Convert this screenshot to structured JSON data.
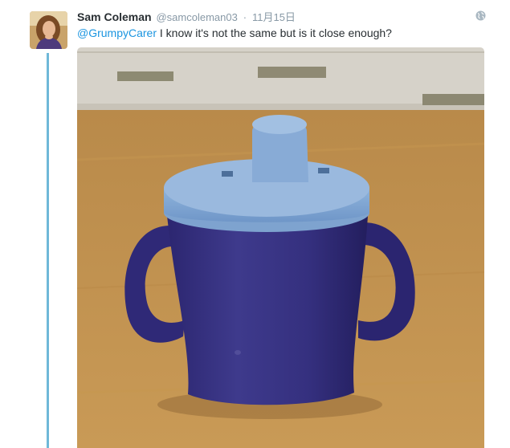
{
  "tweet": {
    "display_name": "Sam Coleman",
    "handle": "@samcoleman03",
    "separator": "·",
    "timestamp": "11月15日",
    "mention": "@GrumpyCarer",
    "text": " I know it's not the same but is it close enough?",
    "globe_icon": "globe-icon"
  },
  "media": {
    "kind": "photo",
    "subject": "sippy-cup"
  },
  "colors": {
    "thread_line": "#6fb8d8",
    "link": "#1b95e0",
    "name": "#292f33",
    "meta": "#8899a6"
  }
}
